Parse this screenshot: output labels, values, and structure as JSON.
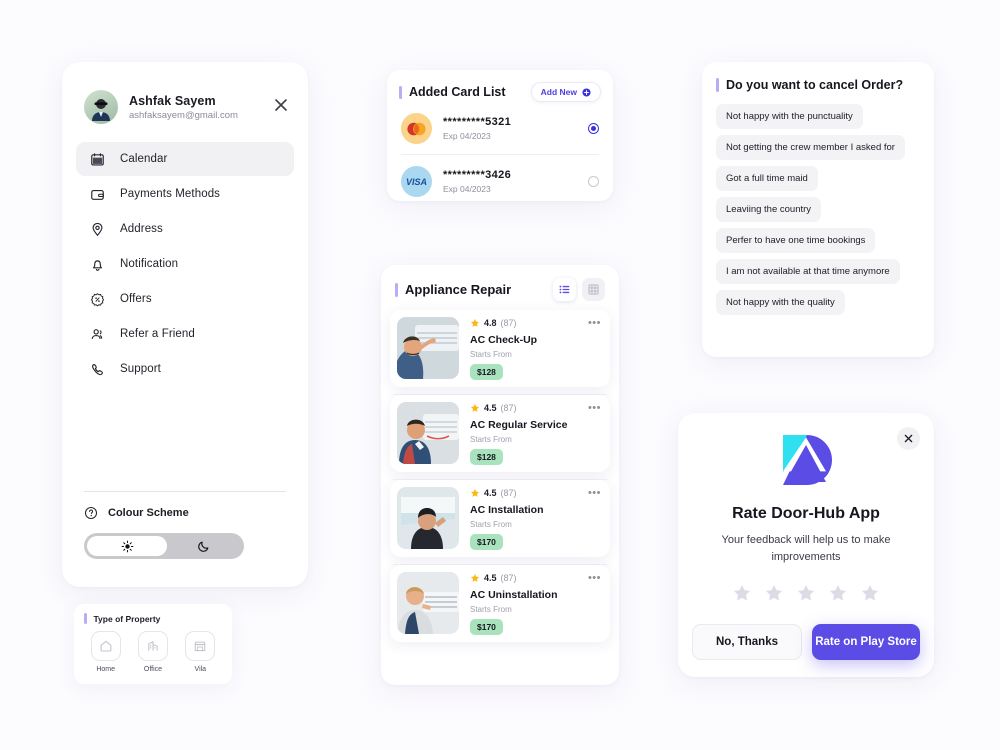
{
  "sidebar": {
    "profile": {
      "name": "Ashfak Sayem",
      "email": "ashfaksayem@gmail.com",
      "avatar_icon": "user-avatar",
      "close_icon": "close-icon"
    },
    "items": [
      {
        "label": "Calendar",
        "icon": "calendar-icon",
        "active": true
      },
      {
        "label": "Payments Methods",
        "icon": "wallet-icon",
        "active": false
      },
      {
        "label": "Address",
        "icon": "location-pin-icon",
        "active": false
      },
      {
        "label": "Notification",
        "icon": "bell-icon",
        "active": false
      },
      {
        "label": "Offers",
        "icon": "discount-badge-icon",
        "active": false
      },
      {
        "label": "Refer a Friend",
        "icon": "people-icon",
        "active": false
      },
      {
        "label": "Support",
        "icon": "phone-icon",
        "active": false
      }
    ],
    "colour_scheme": {
      "label": "Colour Scheme",
      "help_icon": "question-circle-icon",
      "light_icon": "sun-icon",
      "dark_icon": "moon-icon",
      "selected": "light"
    }
  },
  "property": {
    "title": "Type of Property",
    "options": [
      {
        "label": "Home",
        "icon": "home-icon"
      },
      {
        "label": "Office",
        "icon": "office-building-icon"
      },
      {
        "label": "Vila",
        "icon": "store-icon"
      }
    ]
  },
  "card_list": {
    "title": "Added Card List",
    "add_new_label": "Add New",
    "add_new_icon": "plus-circle-icon",
    "cards": [
      {
        "number": "*********5321",
        "expiry": "Exp 04/2023",
        "brand": "mastercard",
        "selected": true
      },
      {
        "number": "*********3426",
        "expiry": "Exp 04/2023",
        "brand": "visa",
        "selected": false
      }
    ]
  },
  "repair": {
    "title": "Appliance Repair",
    "view_list_icon": "list-view-icon",
    "view_grid_icon": "grid-view-icon",
    "view_selected": "list",
    "menu_icon": "more-horizontal-icon",
    "star_icon": "star-icon",
    "services": [
      {
        "rating": "4.8",
        "reviews": "(87)",
        "name": "AC Check-Up",
        "starts_from": "Starts From",
        "price": "$128",
        "thumb": "ac-checkup-photo"
      },
      {
        "rating": "4.5",
        "reviews": "(87)",
        "name": "AC Regular Service",
        "starts_from": "Starts From",
        "price": "$128",
        "thumb": "ac-regular-service-photo"
      },
      {
        "rating": "4.5",
        "reviews": "(87)",
        "name": "AC Installation",
        "starts_from": "Starts From",
        "price": "$170",
        "thumb": "ac-installation-photo"
      },
      {
        "rating": "4.5",
        "reviews": "(87)",
        "name": "AC Uninstallation",
        "starts_from": "Starts From",
        "price": "$170",
        "thumb": "ac-uninstallation-photo"
      }
    ]
  },
  "cancel": {
    "title": "Do you want to cancel Order?",
    "reasons": [
      "Not happy with the punctuality",
      "Not getting the crew member I asked for",
      "Got a full time maid",
      "Leaviing the country",
      "Perfer to have one time bookings",
      "I am not available at that time anymore",
      "Not happy with the quality"
    ]
  },
  "rate_dialog": {
    "close_icon": "close-icon",
    "logo_icon": "door-hub-logo",
    "title": "Rate Door-Hub App",
    "subtitle": "Your feedback will help us to make improvements",
    "stars_count": 5,
    "stars_filled": 0,
    "star_icon": "star-icon",
    "secondary_label": "No, Thanks",
    "primary_label": "Rate on Play Store"
  },
  "colors": {
    "accent": "#5b4ce6",
    "accent_bar": "#b7aef5",
    "price_badge": "#a9e3be",
    "background": "#fcfbfe"
  }
}
